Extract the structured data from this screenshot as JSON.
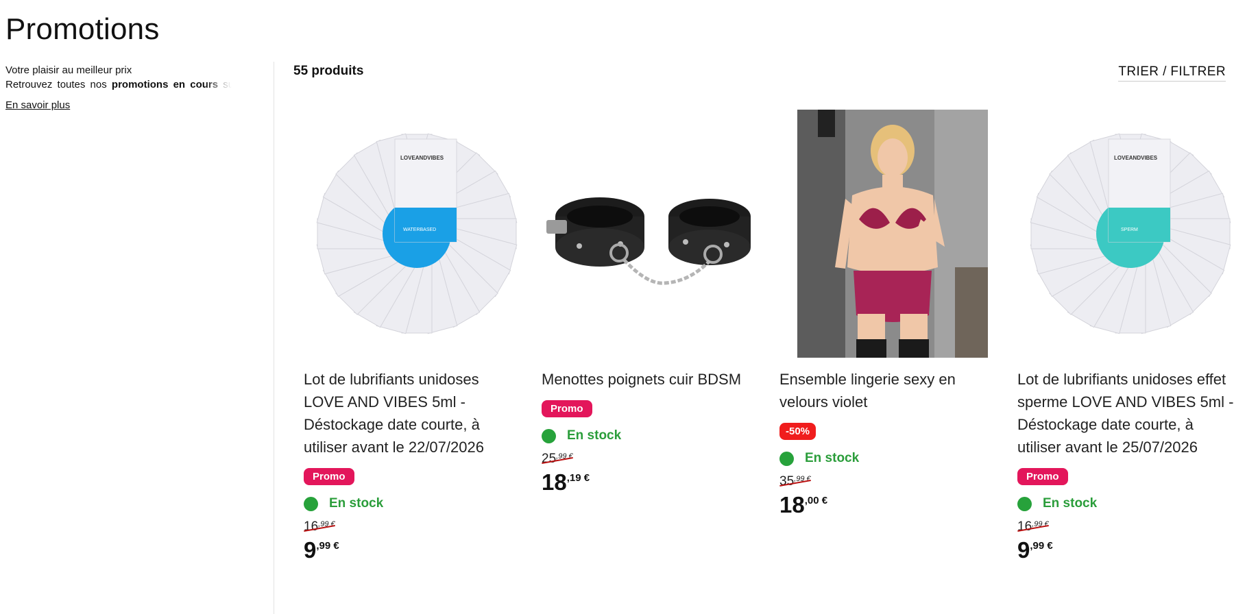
{
  "page": {
    "title": "Promotions",
    "intro_line1": "Votre plaisir au meilleur prix",
    "intro_line2_pre": "Retrouvez toutes nos ",
    "intro_line2_bold": "promotions en cours",
    "intro_line2_post": " su",
    "more_link": "En savoir plus"
  },
  "toolbar": {
    "count": "55 produits",
    "sort_filter": "TRIER / FILTRER"
  },
  "products": [
    {
      "name": "Lot de lubrifiants unidoses LOVE AND VIBES 5ml - Déstockage date courte, à utiliser avant le 22/07/2026",
      "badge": "Promo",
      "stock": "En stock",
      "old_int": "16",
      "old_dec": ",99 €",
      "price_int": "9",
      "price_dec": ",99 €",
      "sachet_brand": "LOVEANDVIBES",
      "sachet_label": "WATERBASED",
      "sachet_color": "#1aa0e6"
    },
    {
      "name": "Menottes poignets cuir BDSM",
      "badge": "Promo",
      "stock": "En stock",
      "old_int": "25",
      "old_dec": ",99 €",
      "price_int": "18",
      "price_dec": ",19 €"
    },
    {
      "name": "Ensemble lingerie sexy en velours violet",
      "badge": "-50%",
      "stock": "En stock",
      "old_int": "35",
      "old_dec": ",99 €",
      "price_int": "18",
      "price_dec": ",00 €"
    },
    {
      "name": "Lot de lubrifiants unidoses effet sperme LOVE AND VIBES 5ml -Déstockage date courte, à utiliser avant le 25/07/2026",
      "badge": "Promo",
      "stock": "En stock",
      "old_int": "16",
      "old_dec": ",99 €",
      "price_int": "9",
      "price_dec": ",99 €",
      "sachet_brand": "LOVEANDVIBES",
      "sachet_label": "SPERM",
      "sachet_color": "#3cc9c3"
    }
  ],
  "colors": {
    "promo_badge": "#e3165b",
    "discount_badge": "#f01d1d",
    "stock_green": "#27a23b"
  }
}
